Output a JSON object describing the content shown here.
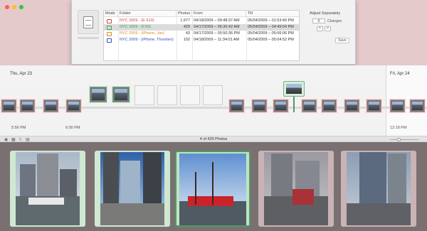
{
  "window": {
    "traffic_lights": [
      "close",
      "minimize",
      "zoom"
    ]
  },
  "sheet": {
    "columns": [
      "Mode",
      "Folder",
      "Photos",
      "From",
      "Till"
    ],
    "rows": [
      {
        "mode_color": "#d04545",
        "folder": "NYC 2009 - (E-510)",
        "folder_color": "#d04545",
        "photos": "1,977",
        "from": "04/18/2009 – 09:48:37 AM",
        "till": "05/04/2009 – 01:53:40 PM",
        "selected": false
      },
      {
        "mode_color": "#3ea04f",
        "folder": "NYC 2009 - (FX0)",
        "folder_color": "#3ea04f",
        "photos": "429",
        "from": "04/17/2009 – 06:30:42 AM",
        "till": "05/04/2009 – 04:49:04 PM",
        "selected": true
      },
      {
        "mode_color": "#e08a20",
        "folder": "NYC 2009 - (iPhone, Jan)",
        "folder_color": "#e08a20",
        "photos": "43",
        "from": "04/17/2009 – 05:50:36 PM",
        "till": "05/04/2009 – 05:06:06 PM",
        "selected": false
      },
      {
        "mode_color": "#2e4fc4",
        "folder": "NYC 2009 - (iPhone, Thorsten)",
        "folder_color": "#2e4fc4",
        "photos": "102",
        "from": "04/18/2009 – 11:34:01 AM",
        "till": "05/04/2009 – 05:04:52 PM",
        "selected": false
      }
    ],
    "adjust_label": "Adjust Separately",
    "adjust_value": "0",
    "changes_label": "Changes",
    "stepper_prev": "<",
    "stepper_next": ">",
    "save_label": "Save"
  },
  "timeline": {
    "left_date": "Thu, Apr 23",
    "right_date": "Fri, Apr 24",
    "time_labels": [
      "5:56 PM",
      "6:00 PM",
      "12:18 PM"
    ]
  },
  "toolbar": {
    "count_label": "4 of 429 Photos"
  }
}
